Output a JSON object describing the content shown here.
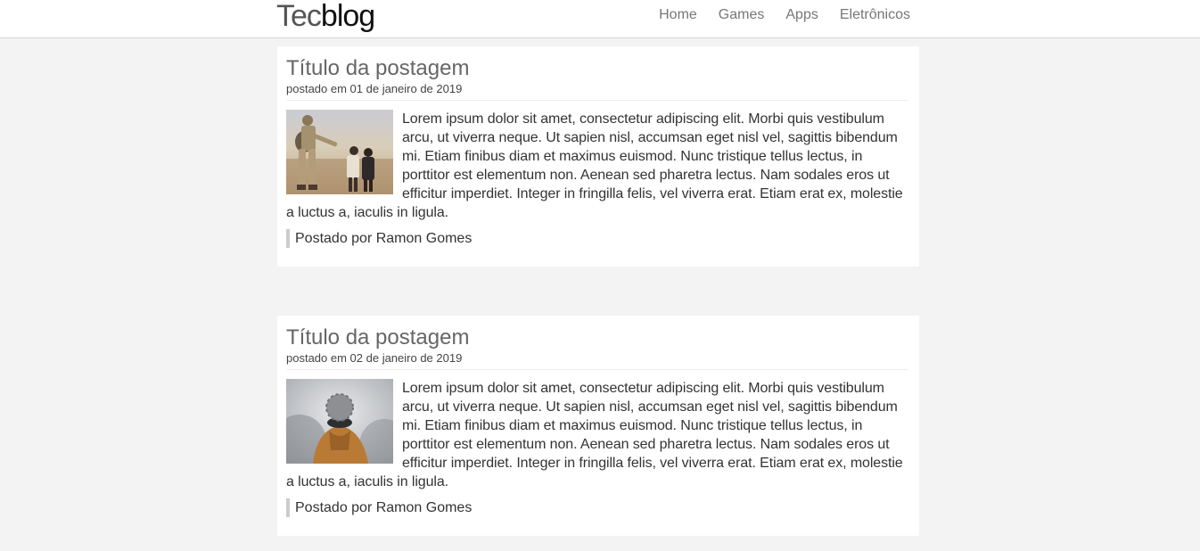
{
  "header": {
    "logo_part1": "Tec",
    "logo_part2": "blog",
    "nav": [
      "Home",
      "Games",
      "Apps",
      "Eletrônicos"
    ]
  },
  "posts": [
    {
      "title": "Título da postagem",
      "date": "postado em 01 de janeiro de 2019",
      "image_icon": "soldier-child-photo",
      "body": "Lorem ipsum dolor sit amet, consectetur adipiscing elit. Morbi quis vestibulum arcu, ut viverra neque. Ut sapien nisl, accumsan eget nisl vel, sagittis bibendum mi. Etiam finibus diam et maximus euismod. Nunc tristique tellus lectus, in porttitor est elementum non. Aenean sed pharetra lectus. Nam sodales eros ut efficitur imperdiet. Integer in fringilla felis, vel viverra erat. Etiam erat ex, molestie a luctus a, iaculis in ligula.",
      "author": "Postado por Ramon Gomes"
    },
    {
      "title": "Título da postagem",
      "date": "postado em 02 de janeiro de 2019",
      "image_icon": "hooded-person-photo",
      "body": "Lorem ipsum dolor sit amet, consectetur adipiscing elit. Morbi quis vestibulum arcu, ut viverra neque. Ut sapien nisl, accumsan eget nisl vel, sagittis bibendum mi. Etiam finibus diam et maximus euismod. Nunc tristique tellus lectus, in porttitor est elementum non. Aenean sed pharetra lectus. Nam sodales eros ut efficitur imperdiet. Integer in fringilla felis, vel viverra erat. Etiam erat ex, molestie a luctus a, iaculis in ligula.",
      "author": "Postado por Ramon Gomes"
    }
  ],
  "colors": {
    "page_bg": "#f3f3f3",
    "card_bg": "#ffffff",
    "title": "#666666",
    "nav_link": "#777777",
    "author_border": "#cccccc"
  }
}
